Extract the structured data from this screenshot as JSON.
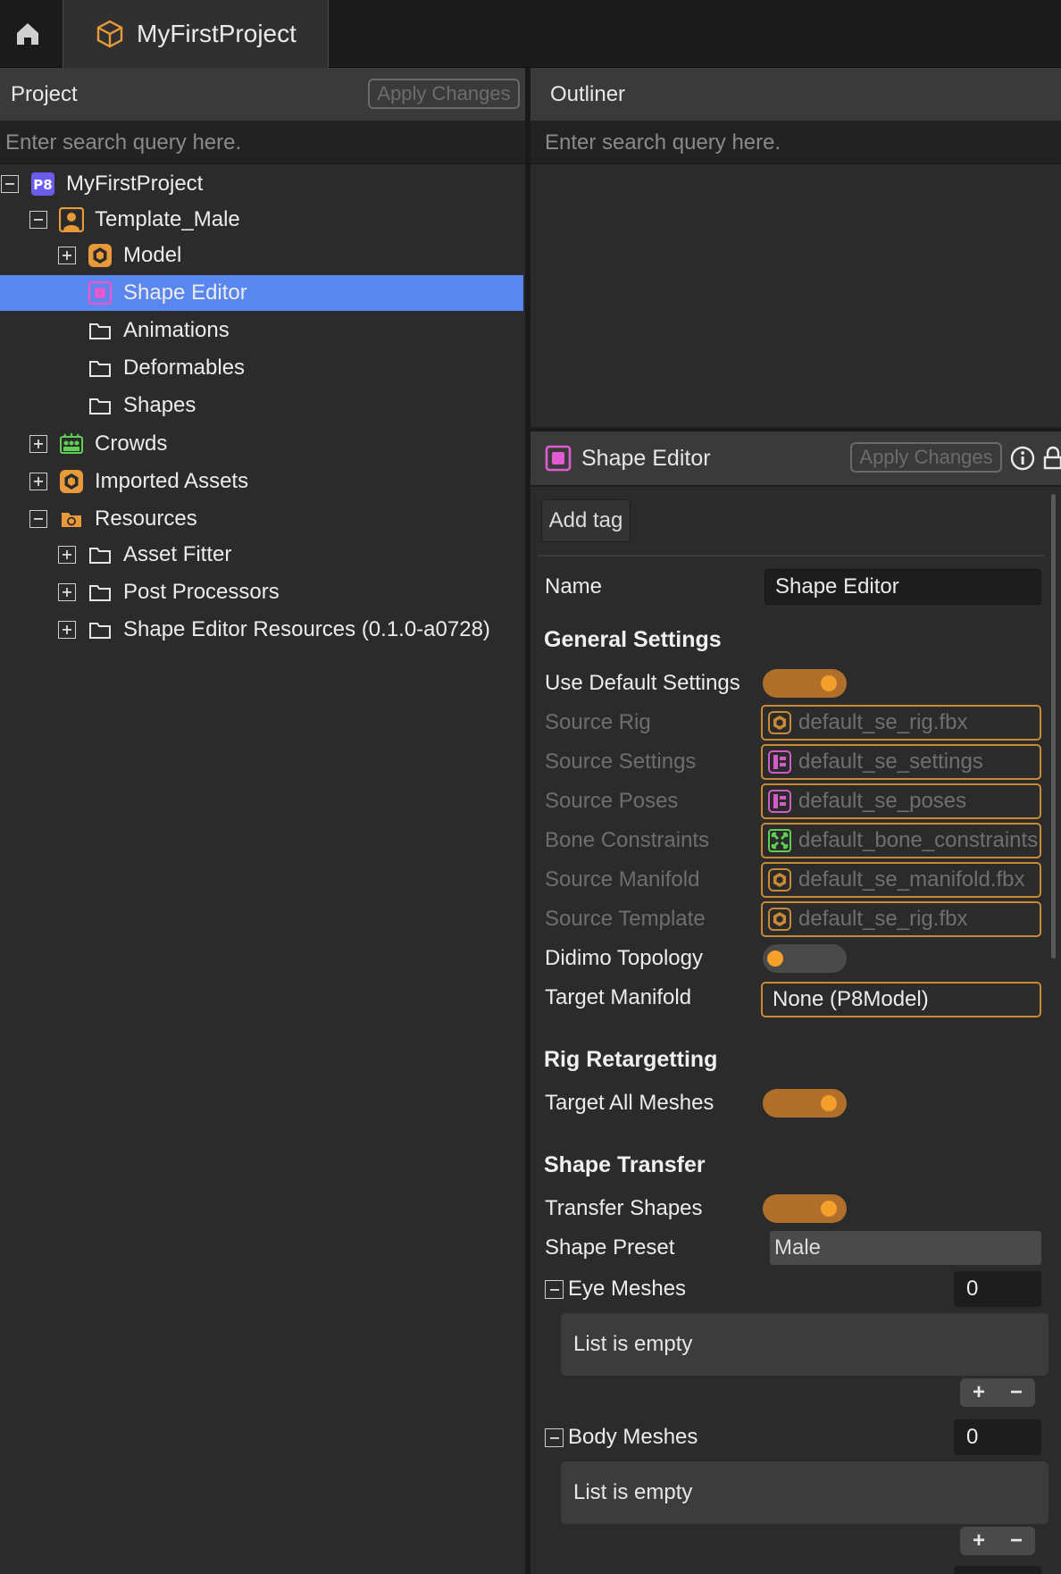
{
  "topbar": {
    "project_tab": "MyFirstProject"
  },
  "project_panel": {
    "title": "Project",
    "apply_label": "Apply Changes",
    "search_placeholder": "Enter search query here.",
    "tree": [
      {
        "label": "MyFirstProject",
        "depth": 0,
        "expander": "minus",
        "icon": "p8-project-icon"
      },
      {
        "label": "Template_Male",
        "depth": 1,
        "expander": "minus",
        "icon": "person-icon"
      },
      {
        "label": "Model",
        "depth": 2,
        "expander": "plus",
        "icon": "hexagon-model-icon"
      },
      {
        "label": "Shape Editor",
        "depth": 2,
        "expander": "none",
        "icon": "shape-editor-icon",
        "selected": true
      },
      {
        "label": "Animations",
        "depth": 2,
        "expander": "none",
        "icon": "folder-icon"
      },
      {
        "label": "Deformables",
        "depth": 2,
        "expander": "none",
        "icon": "folder-icon"
      },
      {
        "label": "Shapes",
        "depth": 2,
        "expander": "none",
        "icon": "folder-icon"
      },
      {
        "label": "Crowds",
        "depth": 1,
        "expander": "plus",
        "icon": "crowd-icon"
      },
      {
        "label": "Imported Assets",
        "depth": 1,
        "expander": "plus",
        "icon": "hexagon-model-icon"
      },
      {
        "label": "Resources",
        "depth": 1,
        "expander": "minus",
        "icon": "resources-folder-icon"
      },
      {
        "label": "Asset Fitter",
        "depth": 2,
        "expander": "plus",
        "icon": "folder-icon"
      },
      {
        "label": "Post Processors",
        "depth": 2,
        "expander": "plus",
        "icon": "folder-icon"
      },
      {
        "label": "Shape Editor Resources (0.1.0-a0728)",
        "depth": 2,
        "expander": "plus",
        "icon": "folder-icon"
      }
    ]
  },
  "outliner": {
    "title": "Outliner",
    "search_placeholder": "Enter search query here."
  },
  "inspector": {
    "title": "Shape Editor",
    "apply_label": "Apply Changes",
    "add_tag": "Add tag",
    "name_label": "Name",
    "name_value": "Shape Editor",
    "general_settings": {
      "title": "General Settings",
      "use_default_label": "Use Default Settings",
      "use_default_on": true,
      "source_rig_label": "Source Rig",
      "source_rig_value": "default_se_rig.fbx",
      "source_settings_label": "Source Settings",
      "source_settings_value": "default_se_settings",
      "source_poses_label": "Source Poses",
      "source_poses_value": "default_se_poses",
      "bone_constraints_label": "Bone Constraints",
      "bone_constraints_value": "default_bone_constraints",
      "source_manifold_label": "Source Manifold",
      "source_manifold_value": "default_se_manifold.fbx",
      "source_template_label": "Source Template",
      "source_template_value": "default_se_rig.fbx",
      "didimo_label": "Didimo Topology",
      "didimo_on": false,
      "target_manifold_label": "Target Manifold",
      "target_manifold_value": "None (P8Model)"
    },
    "rig_retargetting": {
      "title": "Rig Retargetting",
      "target_all_label": "Target All Meshes",
      "target_all_on": true
    },
    "shape_transfer": {
      "title": "Shape Transfer",
      "transfer_label": "Transfer Shapes",
      "transfer_on": true,
      "preset_label": "Shape Preset",
      "preset_value": "Male",
      "eye_meshes_label": "Eye Meshes",
      "eye_meshes_count": "0",
      "eye_list_empty": "List is empty",
      "body_meshes_label": "Body Meshes",
      "body_meshes_count": "0",
      "body_list_empty": "List is empty",
      "add_symbol": "+",
      "remove_symbol": "−"
    }
  },
  "colors": {
    "accent_orange": "#c98a37",
    "selection_blue": "#5a86f0",
    "toggle_on": "#b06f2a"
  }
}
